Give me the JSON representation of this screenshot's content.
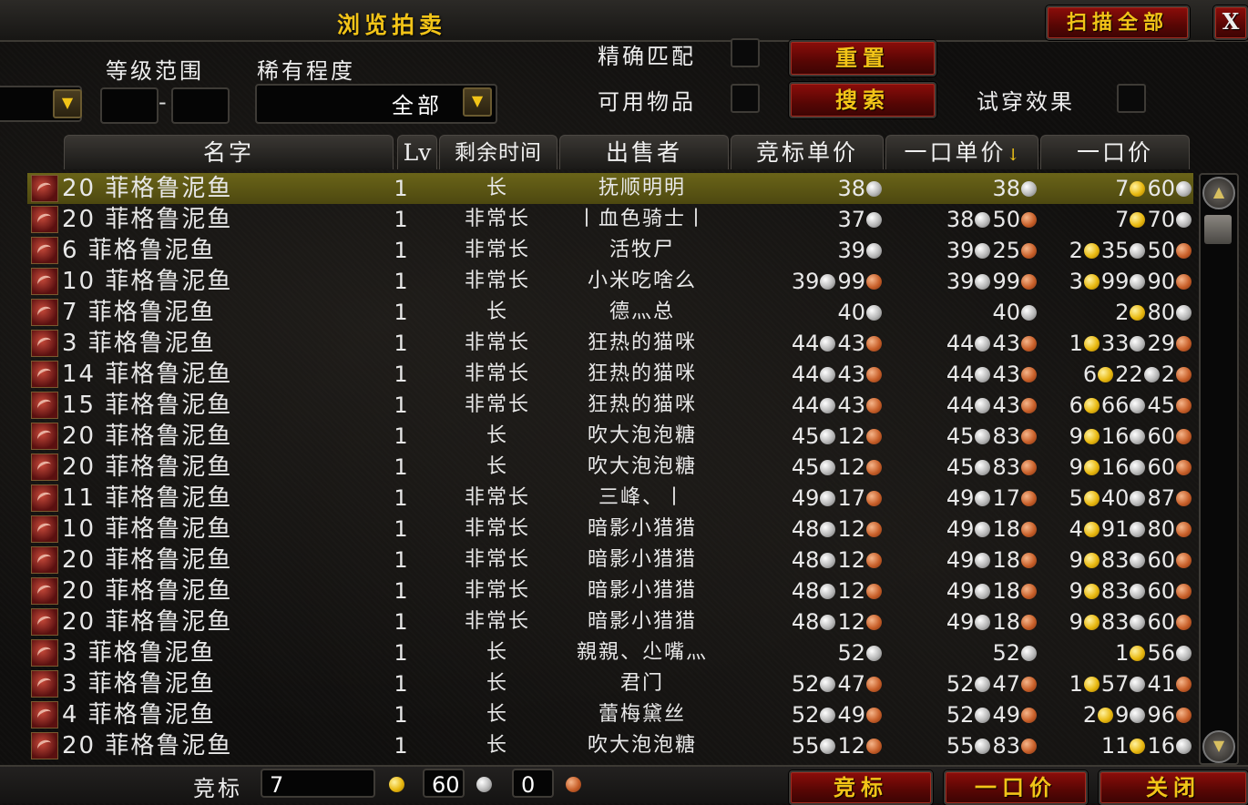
{
  "window": {
    "title": "浏览拍卖",
    "scan_all_label": "扫描全部",
    "close_label": "X"
  },
  "filters": {
    "level_range_label": "等级范围",
    "level_min": "",
    "level_sep": "-",
    "level_max": "",
    "rarity_label": "稀有程度",
    "rarity_value": "全部",
    "exact_match_label": "精确匹配",
    "usable_items_label": "可用物品",
    "preview_label": "试穿效果",
    "reset_label": "重置",
    "search_label": "搜索"
  },
  "columns": {
    "name": "名字",
    "lv": "Lv",
    "time": "剩余时间",
    "seller": "出售者",
    "bid_unit": "竞标单价",
    "buyout_unit": "一口单价",
    "buyout_unit_sort": "↓",
    "buyout": "一口价"
  },
  "rows": [
    {
      "name": "20 菲格鲁泥鱼",
      "lv": "1",
      "time": "长",
      "seller": "抚顺明明",
      "bid": [
        [
          "38",
          "s"
        ]
      ],
      "unit": [
        [
          "38",
          "s"
        ]
      ],
      "buy": [
        [
          "7",
          "g"
        ],
        [
          "60",
          "s"
        ]
      ],
      "selected": true
    },
    {
      "name": "20 菲格鲁泥鱼",
      "lv": "1",
      "time": "非常长",
      "seller": "丨血色骑士丨",
      "bid": [
        [
          "37",
          "s"
        ]
      ],
      "unit": [
        [
          "38",
          "s"
        ],
        [
          "50",
          "c"
        ]
      ],
      "buy": [
        [
          "7",
          "g"
        ],
        [
          "70",
          "s"
        ]
      ]
    },
    {
      "name": "6 菲格鲁泥鱼",
      "lv": "1",
      "time": "非常长",
      "seller": "活牧尸",
      "bid": [
        [
          "39",
          "s"
        ]
      ],
      "unit": [
        [
          "39",
          "s"
        ],
        [
          "25",
          "c"
        ]
      ],
      "buy": [
        [
          "2",
          "g"
        ],
        [
          "35",
          "s"
        ],
        [
          "50",
          "c"
        ]
      ]
    },
    {
      "name": "10 菲格鲁泥鱼",
      "lv": "1",
      "time": "非常长",
      "seller": "小米吃啥么",
      "bid": [
        [
          "39",
          "s"
        ],
        [
          "99",
          "c"
        ]
      ],
      "unit": [
        [
          "39",
          "s"
        ],
        [
          "99",
          "c"
        ]
      ],
      "buy": [
        [
          "3",
          "g"
        ],
        [
          "99",
          "s"
        ],
        [
          "90",
          "c"
        ]
      ]
    },
    {
      "name": "7 菲格鲁泥鱼",
      "lv": "1",
      "time": "长",
      "seller": "德灬总",
      "bid": [
        [
          "40",
          "s"
        ]
      ],
      "unit": [
        [
          "40",
          "s"
        ]
      ],
      "buy": [
        [
          "2",
          "g"
        ],
        [
          "80",
          "s"
        ]
      ]
    },
    {
      "name": "3 菲格鲁泥鱼",
      "lv": "1",
      "time": "非常长",
      "seller": "狂热的猫咪",
      "bid": [
        [
          "44",
          "s"
        ],
        [
          "43",
          "c"
        ]
      ],
      "unit": [
        [
          "44",
          "s"
        ],
        [
          "43",
          "c"
        ]
      ],
      "buy": [
        [
          "1",
          "g"
        ],
        [
          "33",
          "s"
        ],
        [
          "29",
          "c"
        ]
      ]
    },
    {
      "name": "14 菲格鲁泥鱼",
      "lv": "1",
      "time": "非常长",
      "seller": "狂热的猫咪",
      "bid": [
        [
          "44",
          "s"
        ],
        [
          "43",
          "c"
        ]
      ],
      "unit": [
        [
          "44",
          "s"
        ],
        [
          "43",
          "c"
        ]
      ],
      "buy": [
        [
          "6",
          "g"
        ],
        [
          "22",
          "s"
        ],
        [
          "2",
          "c"
        ]
      ]
    },
    {
      "name": "15 菲格鲁泥鱼",
      "lv": "1",
      "time": "非常长",
      "seller": "狂热的猫咪",
      "bid": [
        [
          "44",
          "s"
        ],
        [
          "43",
          "c"
        ]
      ],
      "unit": [
        [
          "44",
          "s"
        ],
        [
          "43",
          "c"
        ]
      ],
      "buy": [
        [
          "6",
          "g"
        ],
        [
          "66",
          "s"
        ],
        [
          "45",
          "c"
        ]
      ]
    },
    {
      "name": "20 菲格鲁泥鱼",
      "lv": "1",
      "time": "长",
      "seller": "吹大泡泡糖",
      "bid": [
        [
          "45",
          "s"
        ],
        [
          "12",
          "c"
        ]
      ],
      "unit": [
        [
          "45",
          "s"
        ],
        [
          "83",
          "c"
        ]
      ],
      "buy": [
        [
          "9",
          "g"
        ],
        [
          "16",
          "s"
        ],
        [
          "60",
          "c"
        ]
      ]
    },
    {
      "name": "20 菲格鲁泥鱼",
      "lv": "1",
      "time": "长",
      "seller": "吹大泡泡糖",
      "bid": [
        [
          "45",
          "s"
        ],
        [
          "12",
          "c"
        ]
      ],
      "unit": [
        [
          "45",
          "s"
        ],
        [
          "83",
          "c"
        ]
      ],
      "buy": [
        [
          "9",
          "g"
        ],
        [
          "16",
          "s"
        ],
        [
          "60",
          "c"
        ]
      ]
    },
    {
      "name": "11 菲格鲁泥鱼",
      "lv": "1",
      "time": "非常长",
      "seller": "三峰、丨",
      "bid": [
        [
          "49",
          "s"
        ],
        [
          "17",
          "c"
        ]
      ],
      "unit": [
        [
          "49",
          "s"
        ],
        [
          "17",
          "c"
        ]
      ],
      "buy": [
        [
          "5",
          "g"
        ],
        [
          "40",
          "s"
        ],
        [
          "87",
          "c"
        ]
      ]
    },
    {
      "name": "10 菲格鲁泥鱼",
      "lv": "1",
      "time": "非常长",
      "seller": "暗影小猎猎",
      "bid": [
        [
          "48",
          "s"
        ],
        [
          "12",
          "c"
        ]
      ],
      "unit": [
        [
          "49",
          "s"
        ],
        [
          "18",
          "c"
        ]
      ],
      "buy": [
        [
          "4",
          "g"
        ],
        [
          "91",
          "s"
        ],
        [
          "80",
          "c"
        ]
      ]
    },
    {
      "name": "20 菲格鲁泥鱼",
      "lv": "1",
      "time": "非常长",
      "seller": "暗影小猎猎",
      "bid": [
        [
          "48",
          "s"
        ],
        [
          "12",
          "c"
        ]
      ],
      "unit": [
        [
          "49",
          "s"
        ],
        [
          "18",
          "c"
        ]
      ],
      "buy": [
        [
          "9",
          "g"
        ],
        [
          "83",
          "s"
        ],
        [
          "60",
          "c"
        ]
      ]
    },
    {
      "name": "20 菲格鲁泥鱼",
      "lv": "1",
      "time": "非常长",
      "seller": "暗影小猎猎",
      "bid": [
        [
          "48",
          "s"
        ],
        [
          "12",
          "c"
        ]
      ],
      "unit": [
        [
          "49",
          "s"
        ],
        [
          "18",
          "c"
        ]
      ],
      "buy": [
        [
          "9",
          "g"
        ],
        [
          "83",
          "s"
        ],
        [
          "60",
          "c"
        ]
      ]
    },
    {
      "name": "20 菲格鲁泥鱼",
      "lv": "1",
      "time": "非常长",
      "seller": "暗影小猎猎",
      "bid": [
        [
          "48",
          "s"
        ],
        [
          "12",
          "c"
        ]
      ],
      "unit": [
        [
          "49",
          "s"
        ],
        [
          "18",
          "c"
        ]
      ],
      "buy": [
        [
          "9",
          "g"
        ],
        [
          "83",
          "s"
        ],
        [
          "60",
          "c"
        ]
      ]
    },
    {
      "name": "3 菲格鲁泥鱼",
      "lv": "1",
      "time": "长",
      "seller": "親親、尐嘴灬",
      "bid": [
        [
          "52",
          "s"
        ]
      ],
      "unit": [
        [
          "52",
          "s"
        ]
      ],
      "buy": [
        [
          "1",
          "g"
        ],
        [
          "56",
          "s"
        ]
      ]
    },
    {
      "name": "3 菲格鲁泥鱼",
      "lv": "1",
      "time": "长",
      "seller": "君门",
      "bid": [
        [
          "52",
          "s"
        ],
        [
          "47",
          "c"
        ]
      ],
      "unit": [
        [
          "52",
          "s"
        ],
        [
          "47",
          "c"
        ]
      ],
      "buy": [
        [
          "1",
          "g"
        ],
        [
          "57",
          "s"
        ],
        [
          "41",
          "c"
        ]
      ]
    },
    {
      "name": "4 菲格鲁泥鱼",
      "lv": "1",
      "time": "长",
      "seller": "蕾梅黛丝",
      "bid": [
        [
          "52",
          "s"
        ],
        [
          "49",
          "c"
        ]
      ],
      "unit": [
        [
          "52",
          "s"
        ],
        [
          "49",
          "c"
        ]
      ],
      "buy": [
        [
          "2",
          "g"
        ],
        [
          "9",
          "s"
        ],
        [
          "96",
          "c"
        ]
      ]
    },
    {
      "name": "20 菲格鲁泥鱼",
      "lv": "1",
      "time": "长",
      "seller": "吹大泡泡糖",
      "bid": [
        [
          "55",
          "s"
        ],
        [
          "12",
          "c"
        ]
      ],
      "unit": [
        [
          "55",
          "s"
        ],
        [
          "83",
          "c"
        ]
      ],
      "buy": [
        [
          "11",
          "g"
        ],
        [
          "16",
          "s"
        ]
      ]
    }
  ],
  "footer": {
    "bid_label": "竞标",
    "bid_gold": "7",
    "bid_silver": "60",
    "bid_copper": "0",
    "bid_button": "竞标",
    "buyout_button": "一口价",
    "close_button": "关闭"
  },
  "colors": {
    "accent_gold": "#f2c418",
    "button_red": "#8c0d0a",
    "selected_row": "#6a6418"
  },
  "icons": {
    "item": "fish-item-icon",
    "sort": "sort-down-icon",
    "scroll_up": "scroll-up-icon",
    "scroll_down": "scroll-down-icon",
    "gold": "gold-coin-icon",
    "silver": "silver-coin-icon",
    "copper": "copper-coin-icon"
  }
}
